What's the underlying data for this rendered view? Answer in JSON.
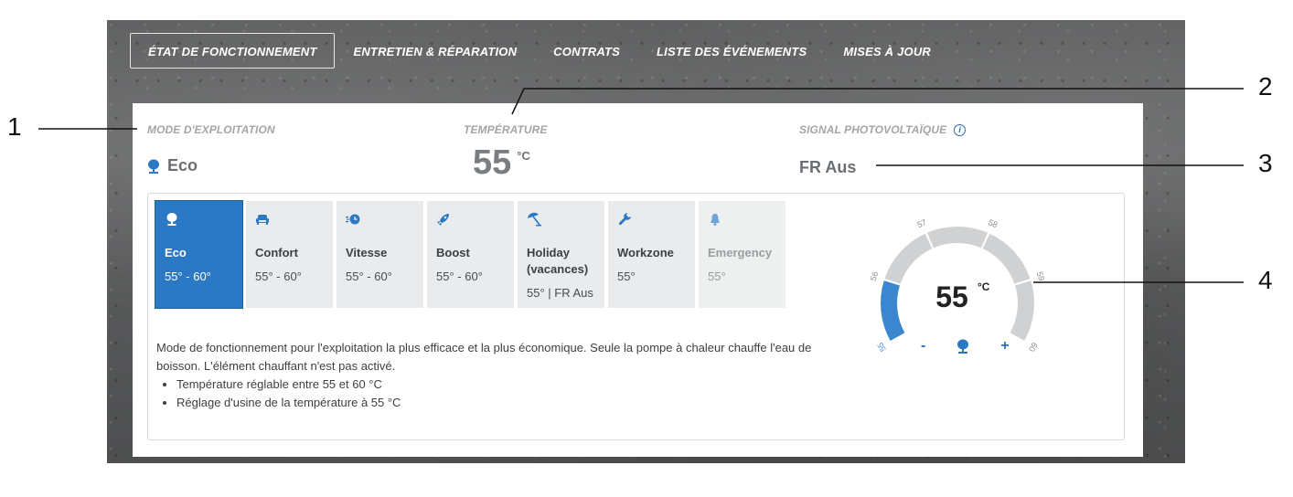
{
  "nav": {
    "tabs": [
      {
        "label": "ÉTAT DE FONCTIONNEMENT",
        "active": true
      },
      {
        "label": "ENTRETIEN & RÉPARATION",
        "active": false
      },
      {
        "label": "CONTRATS",
        "active": false
      },
      {
        "label": "LISTE DES ÉVÉNEMENTS",
        "active": false
      },
      {
        "label": "MISES À JOUR",
        "active": false
      }
    ]
  },
  "status": {
    "mode_label": "MODE D'EXPLOITATION",
    "mode_value": "Eco",
    "temp_label": "TEMPÉRATURE",
    "temp_value": "55",
    "temp_unit": "°C",
    "pv_label": "SIGNAL PHOTOVOLTAÏQUE",
    "pv_value": "FR Aus"
  },
  "modes": [
    {
      "name": "Eco",
      "range": "55° - 60°",
      "icon": "tree-icon",
      "active": true,
      "disabled": false
    },
    {
      "name": "Confort",
      "range": "55° - 60°",
      "icon": "armchair-icon",
      "active": false,
      "disabled": false
    },
    {
      "name": "Vitesse",
      "range": "55° - 60°",
      "icon": "speed-clock-icon",
      "active": false,
      "disabled": false
    },
    {
      "name": "Boost",
      "range": "55° - 60°",
      "icon": "rocket-icon",
      "active": false,
      "disabled": false
    },
    {
      "name": "Holiday (vacances)",
      "range": "55° | FR Aus",
      "icon": "beach-umbrella-icon",
      "active": false,
      "disabled": false
    },
    {
      "name": "Workzone",
      "range": "55°",
      "icon": "wrench-icon",
      "active": false,
      "disabled": false
    },
    {
      "name": "Emergency",
      "range": "55°",
      "icon": "bell-icon",
      "active": false,
      "disabled": true
    }
  ],
  "description": {
    "text": "Mode de fonctionnement pour l'exploitation la plus efficace et la plus économique. Seule la pompe à chaleur chauffe l'eau de boisson. L'élément chauffant n'est pas activé.",
    "bullets": [
      "Température réglable entre 55 et 60 °C",
      "Réglage d'usine de la température à 55 °C"
    ]
  },
  "gauge": {
    "value": "55",
    "unit": "°C",
    "ticks": [
      "55",
      "56",
      "57",
      "58",
      "59",
      "60"
    ],
    "active_segments": 1,
    "minus": "-",
    "plus": "+"
  },
  "callouts": [
    "1",
    "2",
    "3",
    "4"
  ],
  "colors": {
    "accent": "#2b78c4",
    "segment_inactive": "#cfd1d2",
    "segment_active": "#3a87cf"
  }
}
